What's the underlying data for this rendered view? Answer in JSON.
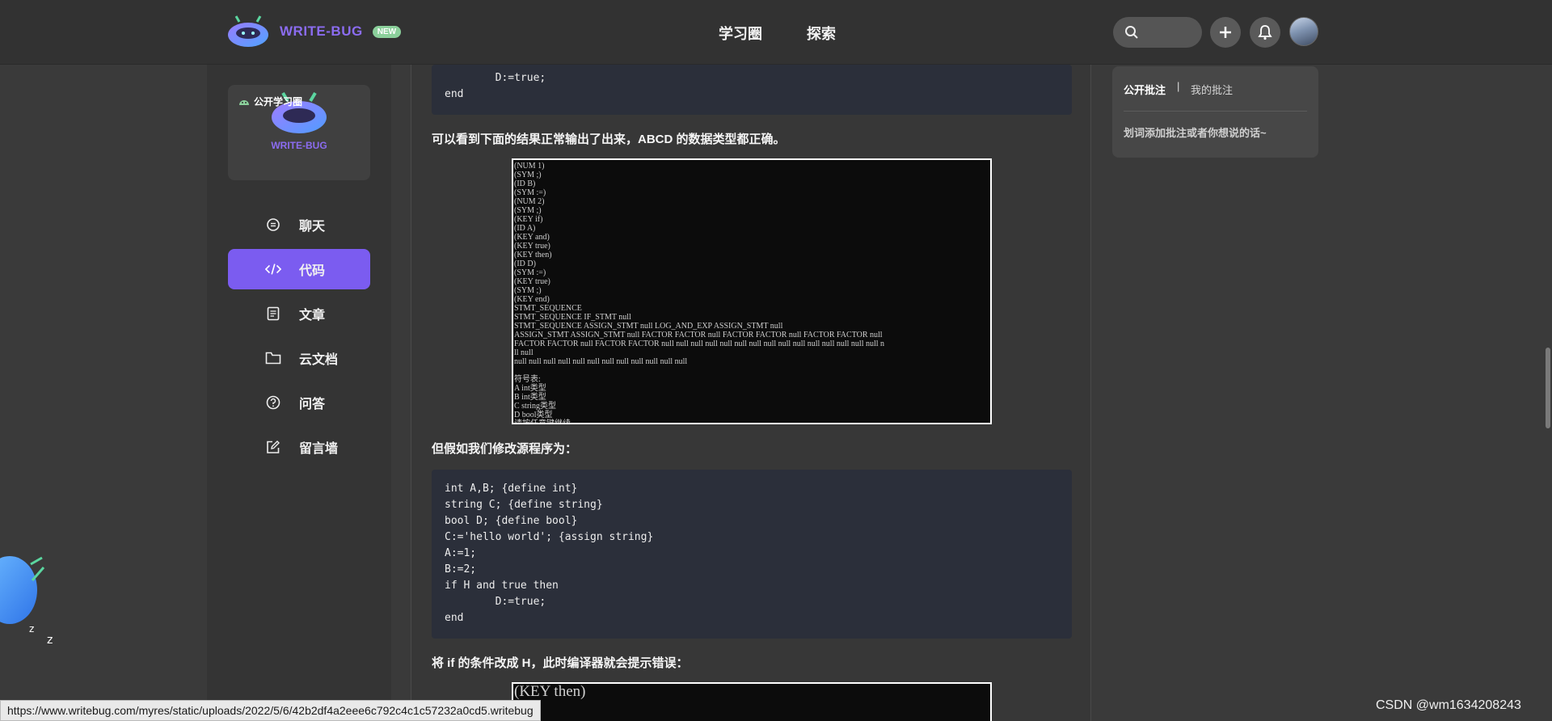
{
  "header": {
    "brand": "WRITE-BUG",
    "badge": "NEW",
    "nav": [
      "学习圈",
      "探索"
    ],
    "icons": [
      "search-icon",
      "plus-icon",
      "bell-icon",
      "avatar"
    ]
  },
  "sidebar": {
    "card": {
      "tag": "公开学习圈",
      "brand": "WRITE-BUG"
    },
    "items": [
      {
        "label": "聊天",
        "icon": "chat-icon"
      },
      {
        "label": "代码",
        "icon": "code-icon",
        "active": true
      },
      {
        "label": "文章",
        "icon": "article-icon"
      },
      {
        "label": "云文档",
        "icon": "folder-icon"
      },
      {
        "label": "问答",
        "icon": "question-icon"
      },
      {
        "label": "留言墙",
        "icon": "edit-icon"
      }
    ]
  },
  "main": {
    "code_top": [
      "        D:=true;",
      "end"
    ],
    "para1": "可以看到下面的结果正常输出了出来，ABCD 的数据类型都正确。",
    "terminal1": [
      "(NUM 1)",
      "(SYM ;)",
      "(ID B)",
      "(SYM :=)",
      "(NUM 2)",
      "(SYM ;)",
      "(KEY if)",
      "(ID A)",
      "(KEY and)",
      "(KEY true)",
      "(KEY then)",
      "(ID D)",
      "(SYM :=)",
      "(KEY true)",
      "(SYM ;)",
      "(KEY end)",
      "STMT_SEQUENCE",
      "STMT_SEQUENCE IF_STMT null",
      "STMT_SEQUENCE ASSIGN_STMT null LOG_AND_EXP ASSIGN_STMT null",
      "ASSIGN_STMT ASSIGN_STMT null FACTOR FACTOR null FACTOR FACTOR null FACTOR FACTOR null",
      "FACTOR FACTOR null FACTOR FACTOR null null null null null null null null null null null null null null null n",
      "ll null",
      "null null null null null null null null null null null null",
      "",
      "符号表:",
      "A int类型",
      "B int类型",
      "C string类型",
      "D bool类型",
      "请按任意键继续. . ."
    ],
    "para2": "但假如我们修改源程序为：",
    "code_block": [
      "int A,B; {define int}",
      "string C; {define string}",
      "bool D; {define bool}",
      "C:='hello world'; {assign string}",
      "A:=1;",
      "B:=2;",
      "if H and true then",
      "        D:=true;",
      "end"
    ],
    "para3": "将 if 的条件改成 H，此时编译器就会提示错误：",
    "terminal2_first": "(KEY then)"
  },
  "annotations": {
    "tab_public": "公开批注",
    "separator": "|",
    "tab_mine": "我的批注",
    "hint": "划词添加批注或者你想说的话~"
  },
  "status_url": "https://www.writebug.com/myres/static/uploads/2022/5/6/42b2df4a2eee6c792c4c1c57232a0cd5.writebug",
  "watermark": "CSDN @wm1634208243",
  "colors": {
    "accent": "#7b5cf0",
    "badge": "#8bd09b",
    "code_bg": "#2b2f3a"
  }
}
